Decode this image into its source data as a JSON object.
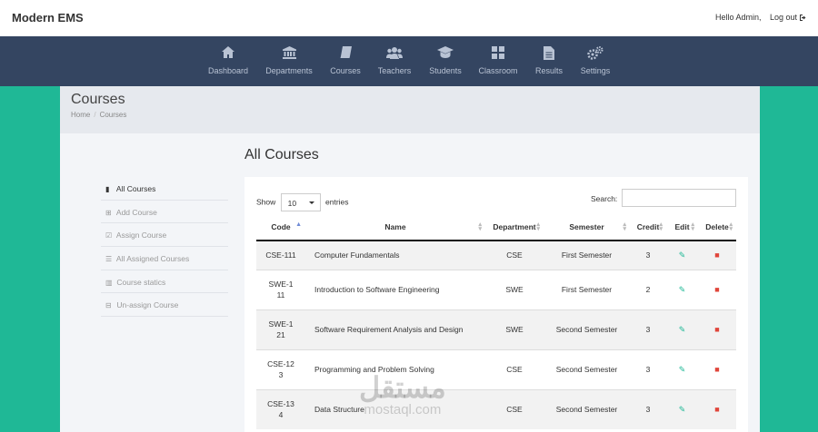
{
  "header": {
    "brand": "Modern EMS",
    "greeting": "Hello Admin,",
    "logout": "Log out"
  },
  "nav": [
    {
      "label": "Dashboard",
      "icon": "home-icon"
    },
    {
      "label": "Departments",
      "icon": "institution-icon"
    },
    {
      "label": "Courses",
      "icon": "book-icon"
    },
    {
      "label": "Teachers",
      "icon": "users-icon"
    },
    {
      "label": "Students",
      "icon": "graduation-cap-icon"
    },
    {
      "label": "Classroom",
      "icon": "grid-icon"
    },
    {
      "label": "Results",
      "icon": "file-icon"
    },
    {
      "label": "Settings",
      "icon": "cogs-icon"
    }
  ],
  "page": {
    "title": "Courses",
    "breadcrumb": [
      "Home",
      "Courses"
    ],
    "section_title": "All Courses"
  },
  "sidebar": [
    {
      "label": "All Courses",
      "icon": "book-icon",
      "glyph": "▮",
      "active": true
    },
    {
      "label": "Add Course",
      "icon": "plus-square-icon",
      "glyph": "⊞",
      "active": false
    },
    {
      "label": "Assign Course",
      "icon": "check-square-icon",
      "glyph": "☑",
      "active": false
    },
    {
      "label": "All Assigned Courses",
      "icon": "list-icon",
      "glyph": "☰",
      "active": false
    },
    {
      "label": "Course statics",
      "icon": "bar-chart-icon",
      "glyph": "▥",
      "active": false
    },
    {
      "label": "Un-assign Course",
      "icon": "minus-square-icon",
      "glyph": "⊟",
      "active": false
    }
  ],
  "table_controls": {
    "show_label": "Show",
    "entries_value": "10",
    "entries_label": "entries",
    "search_label": "Search:",
    "search_value": ""
  },
  "table": {
    "headers": [
      "Code",
      "Name",
      "Department",
      "Semester",
      "Credit",
      "Edit",
      "Delete"
    ],
    "rows": [
      {
        "code": "CSE-111",
        "name": "Computer Fundamentals",
        "dept": "CSE",
        "semester": "First Semester",
        "credit": "3"
      },
      {
        "code": "SWE-111",
        "name": "Introduction to Software Engineering",
        "dept": "SWE",
        "semester": "First Semester",
        "credit": "2"
      },
      {
        "code": "SWE-121",
        "name": "Software Requirement Analysis and Design",
        "dept": "SWE",
        "semester": "Second Semester",
        "credit": "3"
      },
      {
        "code": "CSE-123",
        "name": "Programming and Problem Solving",
        "dept": "CSE",
        "semester": "Second Semester",
        "credit": "3"
      },
      {
        "code": "CSE-134",
        "name": "Data Structure",
        "dept": "CSE",
        "semester": "Second Semester",
        "credit": "3"
      }
    ]
  },
  "watermark": {
    "arabic": "مستقل",
    "latin": "mostaql.com"
  },
  "colors": {
    "background": "#1fb896",
    "navbar": "#344561",
    "edit_icon": "#1fb896",
    "delete_icon": "#e0453a"
  }
}
